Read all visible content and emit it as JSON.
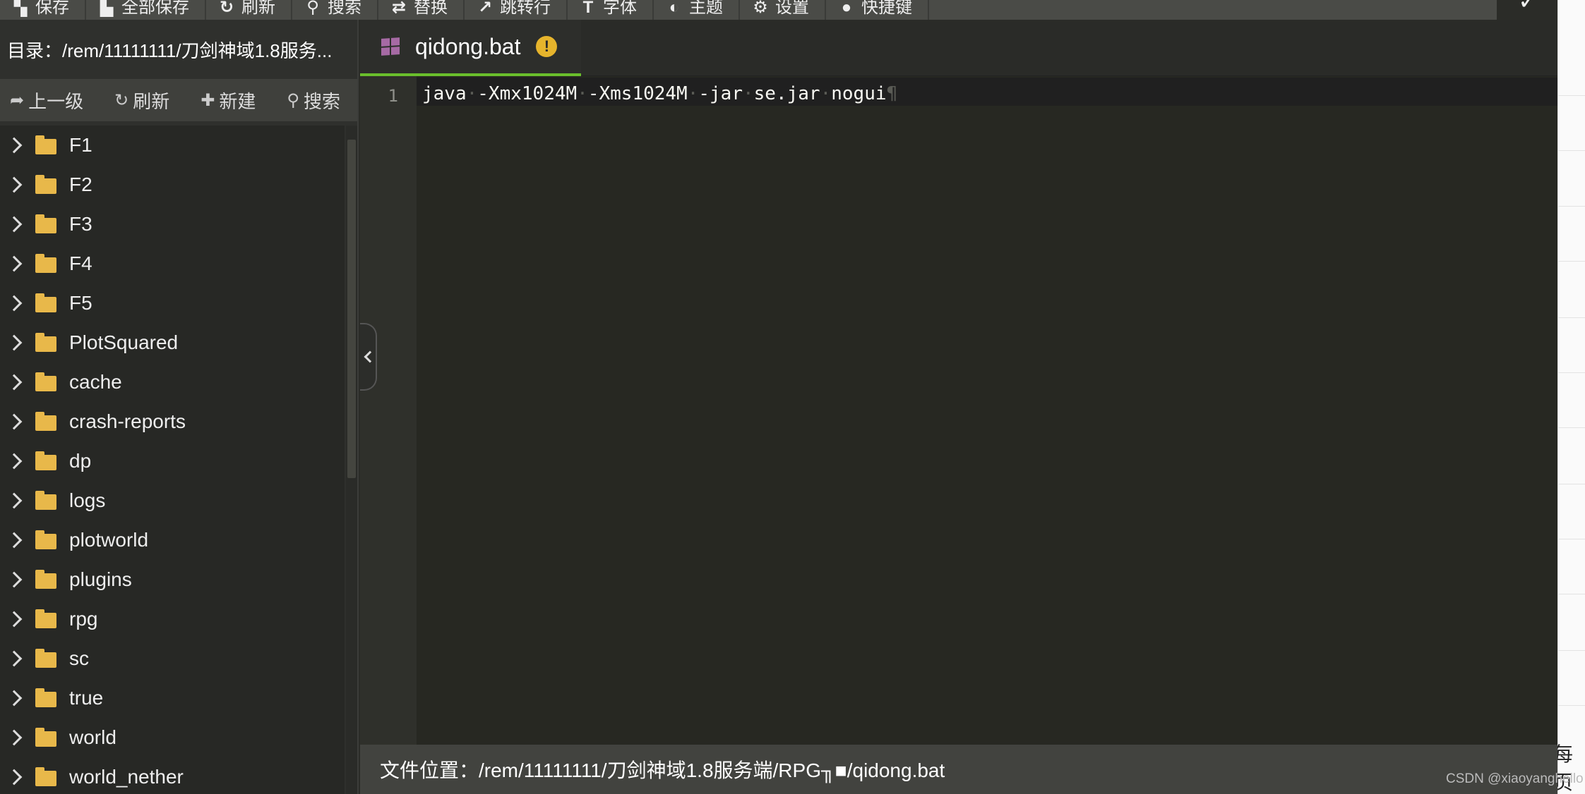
{
  "toolbar": {
    "buttons": [
      {
        "label": "保存",
        "icon": "save-icon"
      },
      {
        "label": "全部保存",
        "icon": "save-all-icon"
      },
      {
        "label": "刷新",
        "icon": "refresh-icon"
      },
      {
        "label": "搜索",
        "icon": "search-icon"
      },
      {
        "label": "替换",
        "icon": "replace-icon"
      },
      {
        "label": "跳转行",
        "icon": "goto-line-icon"
      },
      {
        "label": "字体",
        "icon": "font-icon"
      },
      {
        "label": "主题",
        "icon": "theme-icon"
      },
      {
        "label": "设置",
        "icon": "gear-icon"
      },
      {
        "label": "快捷键",
        "icon": "keyboard-icon"
      }
    ],
    "confirm_icon": "check-icon"
  },
  "sidebar": {
    "directory": "目录：/rem/11111111/刀剑神域1.8服务...",
    "actions": {
      "up": "上一级",
      "refresh": "刷新",
      "new": "新建",
      "search": "搜索"
    },
    "folders": [
      "F1",
      "F2",
      "F3",
      "F4",
      "F5",
      "PlotSquared",
      "cache",
      "crash-reports",
      "dp",
      "logs",
      "plotworld",
      "plugins",
      "rpg",
      "sc",
      "true",
      "world",
      "world_nether"
    ]
  },
  "editor": {
    "tab": {
      "title": "qidong.bat",
      "icon": "windows-file-icon",
      "warning": "!"
    },
    "line_number": "1",
    "code": [
      "java",
      "-Xmx1024M",
      "-Xms1024M",
      "-jar",
      "se.jar",
      "nogui"
    ],
    "pilcrow": "¶"
  },
  "statusbar": {
    "file_location": "文件位置：/rem/11111111/刀剑神域1.8服务端/RPG╖■/qidong.bat"
  },
  "background": {
    "page_text": "每页",
    "watermark": "CSDN @xiaoyanghello"
  },
  "colors": {
    "tab_accent": "#6abf2c",
    "folder": "#e8b84a",
    "warning": "#e6b42c",
    "editor_bg": "#272822"
  }
}
